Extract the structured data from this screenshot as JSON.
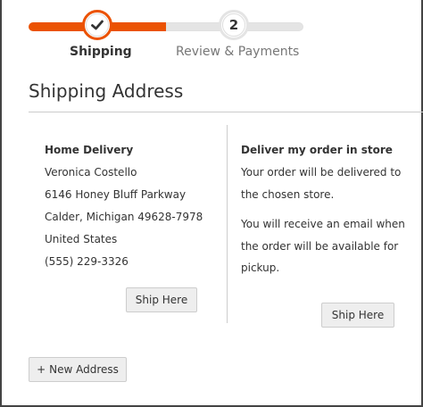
{
  "progress": {
    "steps": [
      {
        "label": "Shipping",
        "number": "",
        "state": "done"
      },
      {
        "label": "Review & Payments",
        "number": "2",
        "state": "todo"
      }
    ],
    "accent_color": "#eb5202"
  },
  "section": {
    "title": "Shipping Address"
  },
  "home_delivery": {
    "title": "Home Delivery",
    "name": "Veronica Costello",
    "street": "6146 Honey Bluff Parkway",
    "city_line": "Calder, Michigan 49628-7978",
    "country": "United States",
    "phone": "(555) 229-3326",
    "button_label": "Ship Here"
  },
  "store_delivery": {
    "title": "Deliver my order in store",
    "para1": "Your order will be delivered to the chosen store.",
    "para2": "You will receive an email when the order will be available for pickup.",
    "button_label": "Ship Here"
  },
  "new_address": {
    "icon": "plus-icon",
    "label": "New Address"
  }
}
